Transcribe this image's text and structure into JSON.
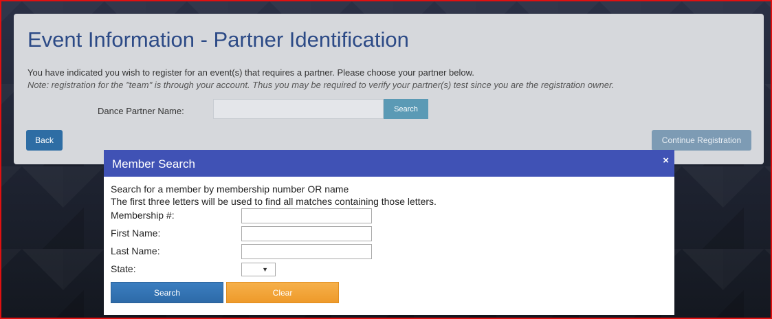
{
  "page": {
    "title": "Event Information - Partner Identification",
    "description": "You have indicated you wish to register for an event(s) that requires a partner. Please choose your partner below.",
    "note": "Note: registration for the \"team\" is through your account. Thus you may be required to verify your partner(s) test since you are the registration owner.",
    "partner_label": "Dance Partner Name:",
    "partner_value": "",
    "partner_search_label": "Search",
    "back_label": "Back",
    "continue_label": "Continue Registration"
  },
  "modal": {
    "title": "Member Search",
    "close_glyph": "×",
    "instructions_1": "Search for a member by membership number OR name",
    "instructions_2": "The first three letters will be used to find all matches containing those letters.",
    "fields": {
      "membership_label": "Membership #:",
      "membership_value": "",
      "first_name_label": "First Name:",
      "first_name_value": "",
      "last_name_label": "Last Name:",
      "last_name_value": "",
      "state_label": "State:",
      "state_value": "",
      "state_arrow": "▼"
    },
    "search_label": "Search",
    "clear_label": "Clear"
  },
  "colors": {
    "frame_border": "#e01010",
    "title_blue": "#2c4a86",
    "modal_header": "#4052b5",
    "primary_button": "#2e6da4",
    "clear_button": "#ee9a2a"
  }
}
